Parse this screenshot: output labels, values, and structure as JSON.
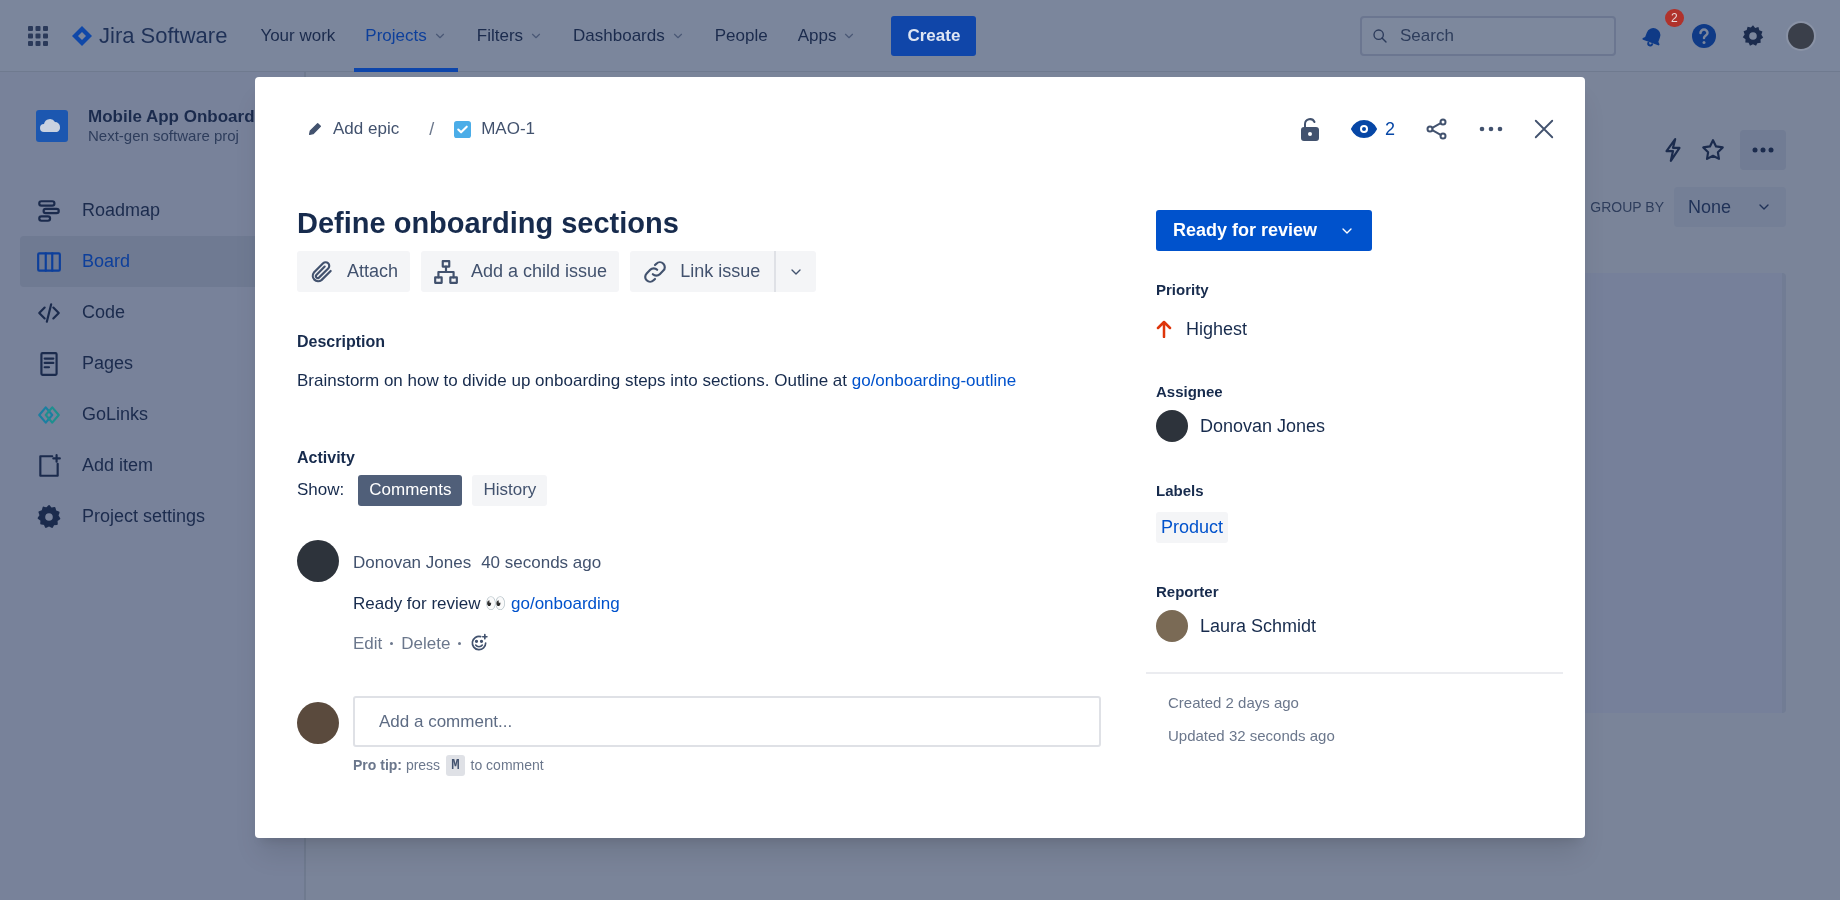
{
  "top_nav": {
    "product": "Jira Software",
    "items": [
      {
        "label": "Your work",
        "selected": false,
        "dropdown": false
      },
      {
        "label": "Projects",
        "selected": true,
        "dropdown": true
      },
      {
        "label": "Filters",
        "selected": false,
        "dropdown": true
      },
      {
        "label": "Dashboards",
        "selected": false,
        "dropdown": true
      },
      {
        "label": "People",
        "selected": false,
        "dropdown": false
      },
      {
        "label": "Apps",
        "selected": false,
        "dropdown": true
      }
    ],
    "create_button": "Create",
    "search": {
      "placeholder": "Search"
    },
    "notifications_count": "2"
  },
  "sidebar": {
    "project_name": "Mobile App Onboard",
    "project_type": "Next-gen software proj",
    "items": [
      {
        "label": "Roadmap",
        "selected": false
      },
      {
        "label": "Board",
        "selected": true
      },
      {
        "label": "Code",
        "selected": false
      },
      {
        "label": "Pages",
        "selected": false
      },
      {
        "label": "GoLinks",
        "selected": false
      },
      {
        "label": "Add item",
        "selected": false
      },
      {
        "label": "Project settings",
        "selected": false
      }
    ]
  },
  "board_toolbar": {
    "group_by_label": "GROUP BY",
    "group_by_value": "None"
  },
  "issue": {
    "breadcrumb": {
      "epic": "Add epic",
      "separator": "/",
      "key": "MAO-1"
    },
    "watchers_count": "2",
    "title": "Define onboarding sections",
    "actions": [
      {
        "label": "Attach"
      },
      {
        "label": "Add a child issue"
      },
      {
        "label": "Link issue"
      }
    ],
    "description": {
      "heading": "Description",
      "text": "Brainstorm on how to divide up onboarding steps into sections. Outline at ",
      "link": "go/onboarding-outline"
    },
    "activity": {
      "heading": "Activity",
      "show_label": "Show:",
      "filters": [
        {
          "label": "Comments",
          "selected": true
        },
        {
          "label": "History",
          "selected": false
        }
      ],
      "comments": [
        {
          "author": "Donovan Jones",
          "time": "40 seconds ago",
          "text": "Ready for review 👀 ",
          "link": "go/onboarding",
          "actions": [
            "Edit",
            "Delete"
          ]
        }
      ],
      "comment_box": {
        "placeholder": "Add a comment...",
        "tip": "**Pro tip:** press",
        "key": "M",
        "tip_end": "to comment"
      }
    },
    "status": "Ready for review",
    "fields": [
      {
        "label": "Priority",
        "value": "Highest",
        "kind": "priority"
      },
      {
        "label": "Assignee",
        "value": "Donovan Jones",
        "kind": "user"
      },
      {
        "label": "Labels",
        "value": "Product",
        "kind": "label"
      },
      {
        "label": "Reporter",
        "value": "Laura Schmidt",
        "kind": "user"
      }
    ],
    "created": "Created 2 days ago",
    "updated": "Updated 32 seconds ago"
  }
}
